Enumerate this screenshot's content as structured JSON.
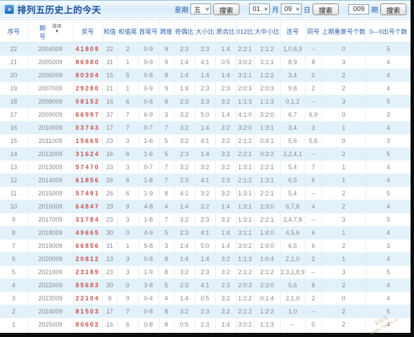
{
  "header": {
    "title": "排列五历史上的今天",
    "week_label": "星期",
    "week_value": "五",
    "month_value": "01",
    "month_label": "月",
    "day_value": "09",
    "day_label": "日",
    "issue_value": "009",
    "issue_label": "期",
    "search_label": "搜索"
  },
  "icons": {
    "title_bullet": "»",
    "dropdown_arrow": "∨",
    "sort_arrow": "▼"
  },
  "table": {
    "sort_label": "排序",
    "columns": [
      "序号",
      "期号",
      "奖号",
      "和值",
      "和值尾",
      "首尾号",
      "跨度",
      "奇偶比",
      "大小比",
      "质合比",
      "012比",
      "大中小比",
      "连号",
      "同号",
      "上期重复号个数",
      "0—9出号个数"
    ],
    "rows": [
      [
        "22",
        "2004009",
        "41809",
        "22",
        "2",
        "0-9",
        "9",
        "2:3",
        "2:3",
        "1:4",
        "2:2:1",
        "2:1:2",
        "1,0,8,9",
        "--",
        "0",
        "5"
      ],
      [
        "21",
        "2005009",
        "86980",
        "31",
        "1",
        "0-9",
        "9",
        "1:4",
        "4:1",
        "0:5",
        "3:0:2",
        "3:1:1",
        "8,9",
        "8",
        "3",
        "4"
      ],
      [
        "20",
        "2006009",
        "80304",
        "15",
        "5",
        "0-8",
        "8",
        "1:4",
        "1:4",
        "1:4",
        "3:1:1",
        "1:2:2",
        "3,4",
        "0",
        "2",
        "4"
      ],
      [
        "19",
        "2007009",
        "29280",
        "21",
        "1",
        "0-9",
        "9",
        "1:4",
        "2:3",
        "2:3",
        "2:0:3",
        "2:0:3",
        "9,8",
        "2",
        "2",
        "4"
      ],
      [
        "18",
        "2008009",
        "08152",
        "16",
        "6",
        "0-8",
        "8",
        "2:3",
        "2:3",
        "3:2",
        "1:1:3",
        "1:1:3",
        "0,1,2",
        "--",
        "3",
        "5"
      ],
      [
        "17",
        "2009009",
        "66997",
        "37",
        "7",
        "6-9",
        "3",
        "3:2",
        "5:0",
        "1:4",
        "4:1:0",
        "3:2:0",
        "6,7",
        "6,9",
        "0",
        "3"
      ],
      [
        "16",
        "2010009",
        "03743",
        "17",
        "7",
        "0-7",
        "7",
        "3:2",
        "1:4",
        "3:2",
        "3:2:0",
        "1:3:1",
        "3,4",
        "3",
        "1",
        "4"
      ],
      [
        "15",
        "2011009",
        "15665",
        "23",
        "3",
        "1-6",
        "5",
        "3:2",
        "4:1",
        "3:2",
        "2:1:2",
        "0:4:1",
        "5,6",
        "5,6",
        "0",
        "3"
      ],
      [
        "14",
        "2012009",
        "31624",
        "16",
        "6",
        "1-6",
        "5",
        "2:3",
        "1:4",
        "3:2",
        "2:2:1",
        "0:3:2",
        "3,2,4,1",
        "--",
        "2",
        "5"
      ],
      [
        "13",
        "2013009",
        "57470",
        "23",
        "3",
        "0-7",
        "7",
        "3:2",
        "3:2",
        "3:2",
        "1:3:1",
        "2:2:1",
        "5,4",
        "7",
        "1",
        "4"
      ],
      [
        "12",
        "2014009",
        "61856",
        "26",
        "6",
        "1-8",
        "7",
        "2:3",
        "4:1",
        "2:3",
        "2:1:2",
        "1:3:1",
        "6,5",
        "6",
        "1",
        "4"
      ],
      [
        "11",
        "2015009",
        "57491",
        "26",
        "6",
        "1-9",
        "8",
        "4:1",
        "3:2",
        "3:2",
        "1:3:1",
        "2:2:1",
        "5,4",
        "--",
        "2",
        "5"
      ],
      [
        "10",
        "2016009",
        "64847",
        "29",
        "9",
        "4-8",
        "4",
        "1:4",
        "3:2",
        "1:4",
        "1:3:1",
        "2:3:0",
        "6,7,8",
        "4",
        "2",
        "4"
      ],
      [
        "9",
        "2017009",
        "31784",
        "23",
        "3",
        "1-8",
        "7",
        "3:2",
        "2:3",
        "3:2",
        "1:3:1",
        "2:2:1",
        "3,4,7,8",
        "--",
        "3",
        "5"
      ],
      [
        "8",
        "2018009",
        "49665",
        "30",
        "0",
        "4-9",
        "5",
        "2:3",
        "4:1",
        "1:4",
        "3:1:1",
        "1:4:0",
        "4,5,6",
        "6",
        "1",
        "4"
      ],
      [
        "7",
        "2019009",
        "66856",
        "31",
        "1",
        "5-8",
        "3",
        "1:4",
        "5:0",
        "1:4",
        "3:0:2",
        "1:4:0",
        "6,5",
        "6",
        "2",
        "3"
      ],
      [
        "6",
        "2020009",
        "20812",
        "13",
        "3",
        "0-8",
        "8",
        "1:4",
        "1:4",
        "3:2",
        "1:1:3",
        "1:0:4",
        "2,1,0",
        "2",
        "1",
        "4"
      ],
      [
        "5",
        "2021009",
        "23189",
        "23",
        "3",
        "1-9",
        "8",
        "3:2",
        "2:3",
        "3:2",
        "2:1:2",
        "2:1:2",
        "2,3,1,8,9",
        "--",
        "3",
        "5"
      ],
      [
        "4",
        "2022009",
        "85683",
        "30",
        "0",
        "3-8",
        "5",
        "2:3",
        "4:1",
        "2:3",
        "2:0:3",
        "2:3:0",
        "5,6",
        "8",
        "2",
        "4"
      ],
      [
        "3",
        "2023009",
        "22104",
        "9",
        "9",
        "0-4",
        "4",
        "1:4",
        "0:5",
        "3:2",
        "1:2:2",
        "0:1:4",
        "2,1,0",
        "2",
        "0",
        "4"
      ],
      [
        "2",
        "2024009",
        "81503",
        "17",
        "7",
        "0-8",
        "8",
        "3:2",
        "2:3",
        "3:2",
        "2:1:2",
        "1:2:2",
        "1,0",
        "--",
        "2",
        "5"
      ],
      [
        "1",
        "2025009",
        "80602",
        "16",
        "6",
        "0-8",
        "8",
        "0:5",
        "2:3",
        "1:4",
        "3:0:2",
        "1:1:3",
        "--",
        "0",
        "2",
        "4"
      ]
    ]
  },
  "watermark": {
    "line1": "彩宝贝",
    "line2": "www.78500.cn"
  },
  "colors": {
    "title_text": "#1c4f9c",
    "header_text": "#3465ad",
    "prize_red": "#c9504c",
    "row_alt": "#e3f1fa",
    "cell_text": "#8a8a8a"
  }
}
